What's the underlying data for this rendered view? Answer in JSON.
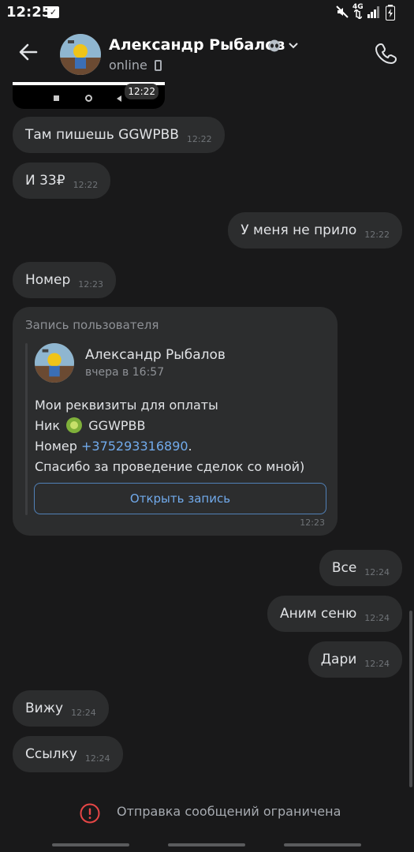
{
  "status_bar": {
    "time": "12:25",
    "network": "4G"
  },
  "header": {
    "contact_name": "Александр Рыбалов",
    "status": "online"
  },
  "screenshot_preview": {
    "time": "12:22"
  },
  "messages": [
    {
      "text": "Там пишешь GGWPBB",
      "time": "12:22",
      "side": "in"
    },
    {
      "text": "И 33₽",
      "time": "12:22",
      "side": "in"
    },
    {
      "text": "У меня не прило",
      "time": "12:22",
      "side": "out"
    },
    {
      "text": "Номер",
      "time": "12:23",
      "side": "in"
    },
    {
      "text": "Все",
      "time": "12:24",
      "side": "out"
    },
    {
      "text": "Аним сеню",
      "time": "12:24",
      "side": "out"
    },
    {
      "text": "Дари",
      "time": "12:24",
      "side": "out"
    },
    {
      "text": "Вижу",
      "time": "12:24",
      "side": "in"
    },
    {
      "text": "Ссылку",
      "time": "12:24",
      "side": "in"
    }
  ],
  "shared_post": {
    "header": "Запись пользователя",
    "author": "Александр Рыбалов",
    "date": "вчера в 16:57",
    "line1": "Мои реквизиты для оплаты",
    "line2_prefix": "Ник",
    "line2_value": "GGWPBB",
    "line3_prefix": "Номер",
    "line3_phone": "+375293316890",
    "line3_suffix": ".",
    "line4": "Спасибо за проведение сделок со мной)",
    "open_button": "Открыть запись",
    "time": "12:23"
  },
  "footer": {
    "notice": "Отправка сообщений ограничена"
  },
  "colors": {
    "background": "#19191a",
    "bubble": "#2c2d2e",
    "accent": "#71aaeb",
    "warning": "#e64646"
  }
}
